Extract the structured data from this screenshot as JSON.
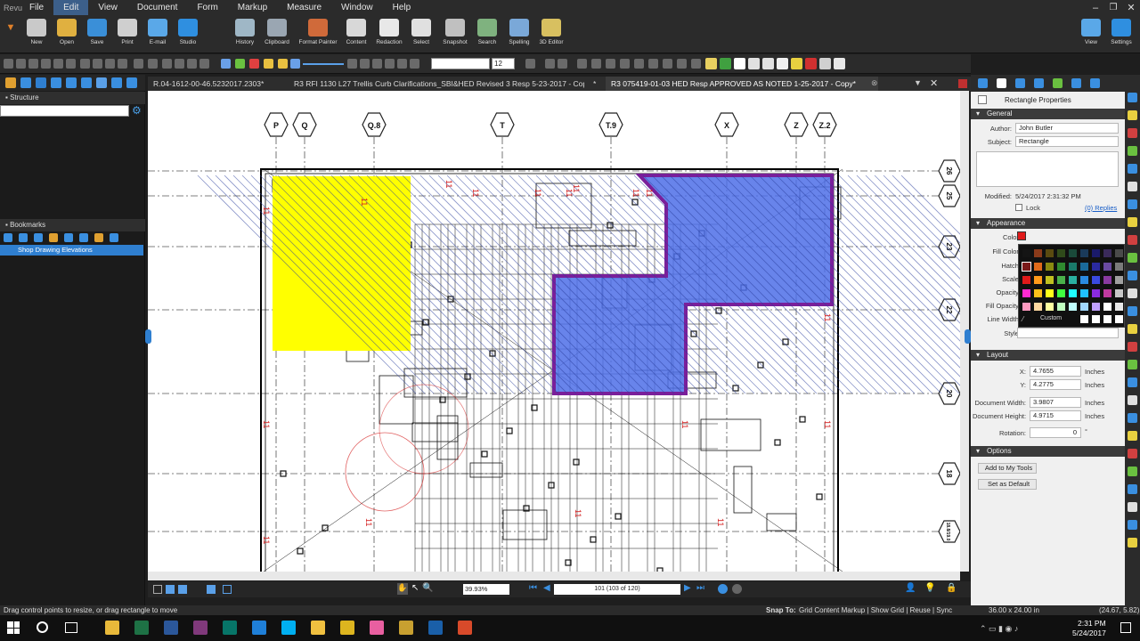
{
  "menu": [
    "File",
    "Edit",
    "View",
    "Document",
    "Form",
    "Markup",
    "Measure",
    "Window",
    "Help"
  ],
  "ribbon": {
    "file": [
      {
        "label": "New",
        "icon": "new-icon",
        "color": "#c9c9c9"
      },
      {
        "label": "Open",
        "icon": "open-folder-icon",
        "color": "#e0b040"
      },
      {
        "label": "Save",
        "icon": "save-icon",
        "color": "#3a8fd8"
      },
      {
        "label": "Print",
        "icon": "print-icon",
        "color": "#cfcfcf"
      },
      {
        "label": "E-mail",
        "icon": "email-icon",
        "color": "#5aa8e8"
      },
      {
        "label": "Studio",
        "icon": "studio-icon",
        "color": "#2f8fe0"
      }
    ],
    "edit": [
      {
        "label": "History",
        "icon": "history-icon",
        "color": "#9fb7c6"
      },
      {
        "label": "Clipboard",
        "icon": "clipboard-icon",
        "color": "#9aa6b2"
      },
      {
        "label": "Format Painter",
        "icon": "format-painter-icon",
        "color": "#d06a3a"
      },
      {
        "label": "Content",
        "icon": "content-icon",
        "color": "#d8d8d8"
      },
      {
        "label": "Redaction",
        "icon": "redaction-icon",
        "color": "#e8e8e8"
      },
      {
        "label": "Select",
        "icon": "select-icon",
        "color": "#e0e0e0"
      },
      {
        "label": "Snapshot",
        "icon": "snapshot-icon",
        "color": "#c0c0c0"
      },
      {
        "label": "Search",
        "icon": "search-binoculars-icon",
        "color": "#7fb27f"
      },
      {
        "label": "Spelling",
        "icon": "spelling-icon",
        "color": "#7aa8d8"
      },
      {
        "label": "3D Editor",
        "icon": "3d-editor-icon",
        "color": "#d8c060"
      }
    ],
    "right": [
      {
        "label": "View",
        "icon": "view-monitor-icon",
        "color": "#5aa8e8"
      },
      {
        "label": "Settings",
        "icon": "settings-icon",
        "color": "#2f8fe0"
      }
    ]
  },
  "toolbar2": {
    "font_size": "12"
  },
  "left_panel": {
    "structure_title": "Structure",
    "bookmarks_title": "Bookmarks",
    "bookmark_item": "Shop Drawing Elevations"
  },
  "tabs": [
    {
      "label": "R.04-1612-00-46.5232017.2303*",
      "active": false
    },
    {
      "label": "R3 RFI 1130 L27 Trellis Curb Clarifications_SBI&HED Revised 3 Resp 5-23-2017 - Copy",
      "active": false
    },
    {
      "label": "*",
      "active": false
    },
    {
      "label": "R3 075419-01-03 HED Resp APPROVED AS NOTED 1-25-2017 - Copy*",
      "active": true
    }
  ],
  "drawing": {
    "grid_top": [
      "P",
      "Q",
      "Q.8",
      "T",
      "T.9",
      "X",
      "Z",
      "Z.2"
    ],
    "grid_right": [
      "26",
      "25",
      "23",
      "22",
      "20",
      "18",
      "18.8/19.0"
    ],
    "markup_colors": {
      "yellow": "#ffff00",
      "blue": "#4d6ee8",
      "border": "#7a1f9a"
    }
  },
  "navbar": {
    "zoom": "39.93%",
    "page": "101 (103 of 120)"
  },
  "props": {
    "title": "Rectangle Properties",
    "general_title": "General",
    "author_label": "Author:",
    "author": "John Butler",
    "subject_label": "Subject:",
    "subject": "Rectangle",
    "modified_label": "Modified:",
    "modified": "5/24/2017 2:31:32 PM",
    "lock_label": "Lock",
    "replies": "(0) Replies",
    "appearance_title": "Appearance",
    "color_label": "Color:",
    "fill_color_label": "Fill Color:",
    "hatch_label": "Hatch:",
    "scale_label": "Scale:",
    "opacity_label": "Opacity:",
    "fill_opacity_label": "Fill Opacity:",
    "line_width_label": "Line Width:",
    "style_label": "Style:",
    "custom_label": "Custom",
    "layout_title": "Layout",
    "x_label": "X:",
    "x": "4.7655",
    "y_label": "Y:",
    "y": "4.2775",
    "unit": "Inches",
    "doc_width_label": "Document Width:",
    "doc_width": "3.9807",
    "doc_height_label": "Document Height:",
    "doc_height": "4.9715",
    "rotation_label": "Rotation:",
    "rotation": "0",
    "rotation_unit": "°",
    "options_title": "Options",
    "add_to_tools": "Add to My Tools",
    "set_default": "Set as Default"
  },
  "palette": {
    "rows": [
      [
        "#141414",
        "#8a3a1a",
        "#5a4a10",
        "#2f4a1a",
        "#1a4a3a",
        "#1a3a5a",
        "#1a1a6a",
        "#3a2a5a",
        "#4a4a4a"
      ],
      [
        "#7a1a1a",
        "#e06a1a",
        "#8a8a10",
        "#2f8a2f",
        "#1a7a6a",
        "#1a6a9a",
        "#2a2aa0",
        "#6a4aa0",
        "#7a7a7a"
      ],
      [
        "#e01a1a",
        "#ff9a1a",
        "#c0c020",
        "#4ab04a",
        "#2ab0a0",
        "#2a8ae0",
        "#3a4ae0",
        "#8a3aa0",
        "#a0a0a0"
      ],
      [
        "#ff2ad0",
        "#ffc01a",
        "#ffff1a",
        "#40ff40",
        "#20ffff",
        "#20c0ff",
        "#8a2ae0",
        "#c03aa0",
        "#c8c8c8"
      ],
      [
        "#ff9ac0",
        "#ffd8a0",
        "#ffffa0",
        "#c0ffc0",
        "#c0ffff",
        "#a0d8ff",
        "#c0a0ff",
        "#ffffff",
        "#e8e8e8"
      ]
    ],
    "last_row": [
      "#ffffff",
      "#ffffff",
      "#ffffff",
      "#ffffff"
    ]
  },
  "status": {
    "hint": "Drag control points to resize, or drag rectangle to move",
    "snap_to": "Snap To:",
    "snap_opts": "Grid  Content  Markup | Show Grid | Reuse | Sync",
    "page_size": "36.00 x 24.00 in",
    "coords": "(24.67, 5.82)"
  },
  "taskbar": {
    "time": "2:31 PM",
    "date": "5/24/2017",
    "apps": [
      {
        "icon": "file-explorer-icon",
        "color": "#e8b93a"
      },
      {
        "icon": "excel-icon",
        "color": "#1e7145"
      },
      {
        "icon": "word-icon",
        "color": "#2b579a"
      },
      {
        "icon": "onenote-icon",
        "color": "#80397b"
      },
      {
        "icon": "publisher-icon",
        "color": "#077568"
      },
      {
        "icon": "edge-icon",
        "color": "#1f7fd8"
      },
      {
        "icon": "skype-icon",
        "color": "#00aff0"
      },
      {
        "icon": "folder-icon",
        "color": "#f0c040"
      },
      {
        "icon": "chrome-icon",
        "color": "#ddb51f"
      },
      {
        "icon": "itunes-icon",
        "color": "#e85fa0"
      },
      {
        "icon": "gear-app-icon",
        "color": "#c8a030"
      },
      {
        "icon": "revu-icon",
        "color": "#1a5fa8"
      },
      {
        "icon": "app-icon",
        "color": "#d84a2a"
      }
    ]
  }
}
